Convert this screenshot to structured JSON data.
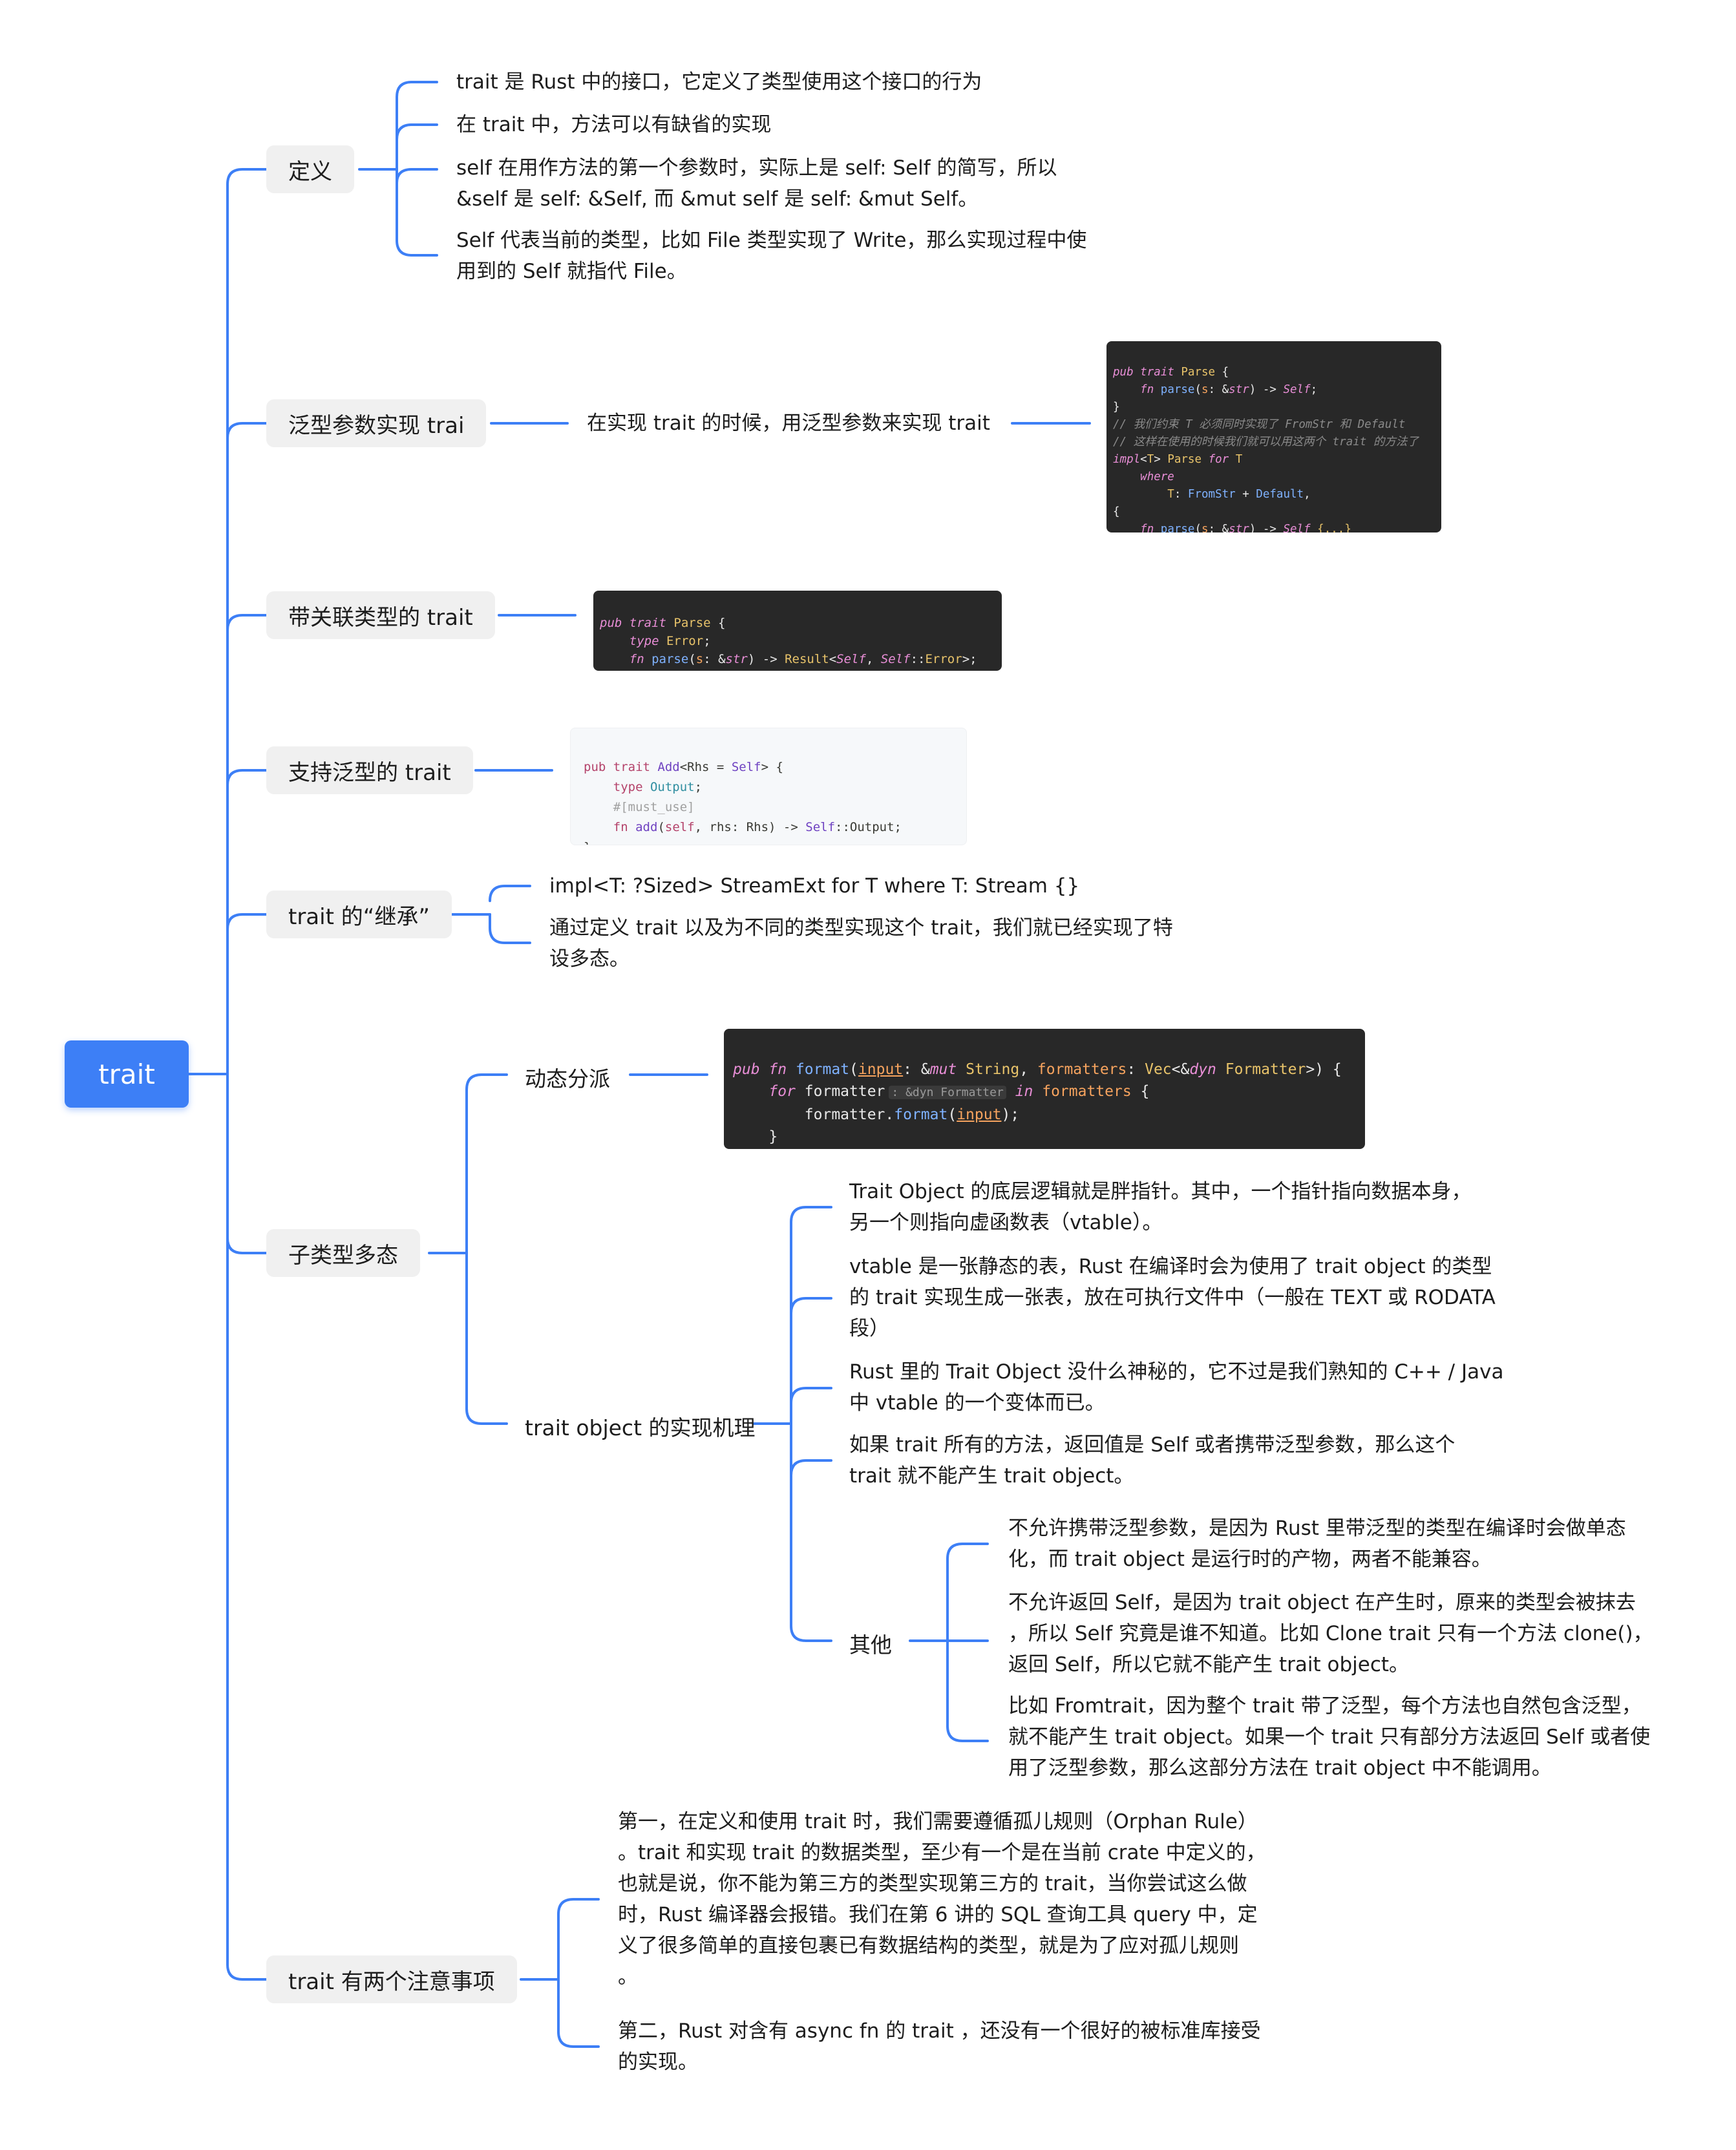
{
  "root": {
    "label": "trait"
  },
  "branches": {
    "definition": {
      "label": "定义",
      "items": [
        [
          "trait 是 Rust 中的接口，它定义了类型使用这个接口的行为"
        ],
        [
          "在 trait 中，方法可以有缺省的实现"
        ],
        [
          "self 在用作方法的第一个参数时，实际上是 self: Self 的简写，所以",
          "&self 是 self: &Self, 而 &mut self 是 self: &mut Self。"
        ],
        [
          "Self 代表当前的类型，比如 File 类型实现了 Write，那么实现过程中使",
          "用到的 Self 就指代 File。"
        ]
      ]
    },
    "generic_impl": {
      "label": "泛型参数实现 trai",
      "text": "在实现 trait  的时候，用泛型参数来实现 trait",
      "code": [
        "pub trait Parse {",
        "    fn parse(s: &str) -> Self;",
        "}",
        "// 我们约束 T 必须同时实现了 FromStr 和 Default",
        "// 这样在使用的时候我们就可以用这两个 trait 的方法了",
        "impl<T> Parse for T",
        "where",
        "    T: FromStr + Default,",
        "{",
        "    fn parse(s: &str) -> Self {...}",
        "}"
      ]
    },
    "associated_type": {
      "label": "带关联类型的 trait",
      "code": [
        "pub trait Parse {",
        "    type Error;",
        "    fn parse(s: &str) -> Result<Self, Self::Error>;",
        "}"
      ]
    },
    "generic_trait": {
      "label": "支持泛型的 trait",
      "code": [
        "pub trait Add<Rhs = Self> {",
        "    type Output;",
        "    #[must_use]",
        "    fn add(self, rhs: Rhs) -> Self::Output;",
        "}"
      ]
    },
    "inheritance": {
      "label": "trait 的“继承”",
      "items": [
        [
          "impl<T: ?Sized> StreamExt for T where T: Stream {}"
        ],
        [
          "通过定义 trait 以及为不同的类型实现这个 trait，我们就已经实现了特",
          "设多态。"
        ]
      ]
    },
    "subtype": {
      "label": "子类型多态",
      "dynamic_dispatch": {
        "label": "动态分派",
        "code": [
          "pub fn format(input: &mut String, formatters: Vec<&dyn Formatter>) {",
          "    for formatter in formatters {",
          "        formatter.format(input);",
          "    }",
          "}"
        ],
        "inlay_hint": ": &dyn Formatter"
      },
      "trait_object": {
        "label": "trait object 的实现机理",
        "items": [
          [
            "Trait Object 的底层逻辑就是胖指针。其中，一个指针指向数据本身，",
            "另一个则指向虚函数表（vtable）。"
          ],
          [
            "vtable 是一张静态的表，Rust 在编译时会为使用了 trait object 的类型",
            "的 trait 实现生成一张表，放在可执行文件中（一般在 TEXT 或 RODATA",
            "段）"
          ],
          [
            "Rust 里的 Trait Object 没什么神秘的，它不过是我们熟知的 C++ / Java",
            "中 vtable 的一个变体而已。"
          ],
          [
            "如果 trait 所有的方法，返回值是 Self 或者携带泛型参数，那么这个",
            "trait 就不能产生 trait object。"
          ]
        ],
        "other": {
          "label": "其他",
          "items": [
            [
              "不允许携带泛型参数，是因为 Rust 里带泛型的类型在编译时会做单态",
              "化，而 trait object 是运行时的产物，两者不能兼容。"
            ],
            [
              "不允许返回 Self，是因为 trait object 在产生时，原来的类型会被抹去",
              "，所以 Self 究竟是谁不知道。比如 Clone trait 只有一个方法 clone()，",
              "返回 Self，所以它就不能产生 trait object。"
            ],
            [
              "比如 Fromtrait，因为整个 trait 带了泛型，每个方法也自然包含泛型，",
              "就不能产生 trait object。如果一个 trait 只有部分方法返回 Self 或者使",
              "用了泛型参数，那么这部分方法在 trait object 中不能调用。"
            ]
          ]
        }
      }
    },
    "notes": {
      "label": "trait 有两个注意事项",
      "items": [
        [
          "第一，在定义和使用 trait 时，我们需要遵循孤儿规则（Orphan Rule）",
          "。trait 和实现 trait 的数据类型，至少有一个是在当前 crate 中定义的，",
          "也就是说，你不能为第三方的类型实现第三方的 trait，当你尝试这么做",
          "时，Rust 编译器会报错。我们在第 6 讲的 SQL 查询工具 query 中，定",
          "义了很多简单的直接包裹已有数据结构的类型，就是为了应对孤儿规则",
          "。"
        ],
        [
          "第二，Rust 对含有 async fn 的 trait ，还没有一个很好的被标准库接受",
          "的实现。"
        ]
      ]
    }
  },
  "colors": {
    "edge": "#3d7ff6",
    "root": "#3d7ff6",
    "branch_bg": "#f0f0f0"
  }
}
